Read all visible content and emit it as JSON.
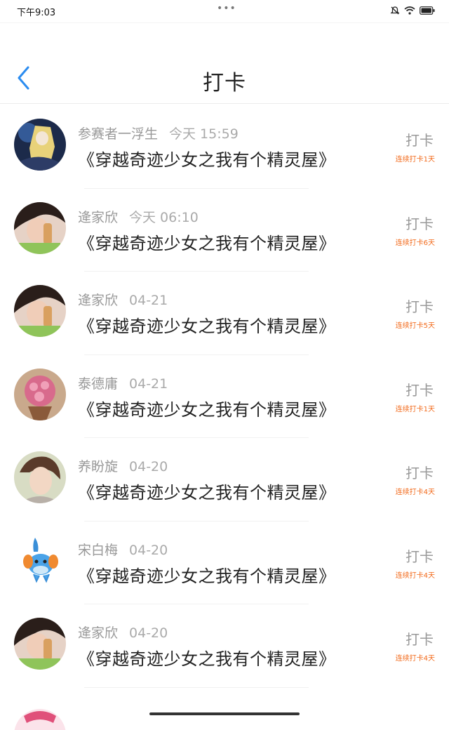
{
  "status_bar": {
    "time": "下午9:03",
    "dots": "•••"
  },
  "header": {
    "title": "打卡"
  },
  "entries": [
    {
      "name": "参赛者一浮生",
      "time": "今天 15:59",
      "book": "《穿越奇迹少女之我有个精灵屋》",
      "action": "打卡",
      "streak": "连续打卡1天"
    },
    {
      "name": "逄家欣",
      "time": "今天 06:10",
      "book": "《穿越奇迹少女之我有个精灵屋》",
      "action": "打卡",
      "streak": "连续打卡6天"
    },
    {
      "name": "逄家欣",
      "time": "04-21",
      "book": "《穿越奇迹少女之我有个精灵屋》",
      "action": "打卡",
      "streak": "连续打卡5天"
    },
    {
      "name": "泰德庸",
      "time": "04-21",
      "book": "《穿越奇迹少女之我有个精灵屋》",
      "action": "打卡",
      "streak": "连续打卡1天"
    },
    {
      "name": "养盼旋",
      "time": "04-20",
      "book": "《穿越奇迹少女之我有个精灵屋》",
      "action": "打卡",
      "streak": "连续打卡4天"
    },
    {
      "name": "宋白梅",
      "time": "04-20",
      "book": "《穿越奇迹少女之我有个精灵屋》",
      "action": "打卡",
      "streak": "连续打卡4天"
    },
    {
      "name": "逄家欣",
      "time": "04-20",
      "book": "《穿越奇迹少女之我有个精灵屋》",
      "action": "打卡",
      "streak": "连续打卡4天"
    }
  ],
  "colors": {
    "accent": "#2b8cf0",
    "streak": "#f26a1b"
  }
}
